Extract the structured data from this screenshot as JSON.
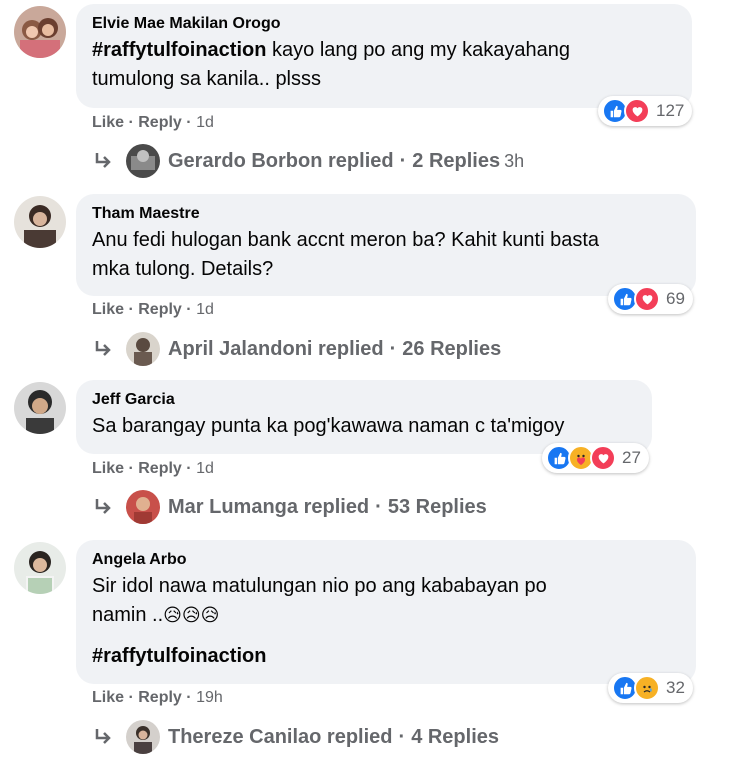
{
  "comments": [
    {
      "author": "Elvie Mae Makilan Orogo",
      "hashtag": "#raffytulfoinaction",
      "text_line1": "kayo lang po ang my kakayahang",
      "text_line2": "tumulong sa kanila.. plsss",
      "reaction_count": "127",
      "reactions": [
        "like-icon",
        "love-icon"
      ],
      "like": "Like",
      "reply": "Reply",
      "time": "1d",
      "reply_author": "Gerardo Borbon replied",
      "reply_count": "2 Replies",
      "reply_time": "3h"
    },
    {
      "author": "Tham Maestre",
      "text_line1": "Anu fedi hulogan bank accnt meron ba? Kahit kunti basta",
      "text_line2": "mka tulong. Details?",
      "reaction_count": "69",
      "reactions": [
        "like-icon",
        "love-icon"
      ],
      "like": "Like",
      "reply": "Reply",
      "time": "1d",
      "reply_author": "April Jalandoni replied",
      "reply_count": "26 Replies"
    },
    {
      "author": "Jeff Garcia",
      "text_line1": "Sa barangay punta ka pog'kawawa naman c ta'migoy",
      "reaction_count": "27",
      "reactions": [
        "like-icon",
        "care-icon",
        "love-icon"
      ],
      "like": "Like",
      "reply": "Reply",
      "time": "1d",
      "reply_author": "Mar Lumanga replied",
      "reply_count": "53 Replies"
    },
    {
      "author": "Angela Arbo",
      "text_line1": "Sir idol nawa matulungan nio po ang kababayan po",
      "text_line2": "namin ..",
      "emoji": "😥😥😥",
      "hashtag": "#raffytulfoinaction",
      "reaction_count": "32",
      "reactions": [
        "like-icon",
        "sad-icon"
      ],
      "like": "Like",
      "reply": "Reply",
      "time": "19h",
      "reply_author": "Thereze Canilao replied",
      "reply_count": "4 Replies"
    }
  ],
  "separator": "·",
  "colors": {
    "bubble": "#f0f2f5",
    "secondary_text": "#65676b",
    "like_blue": "#1877f2",
    "love_red": "#f33e58",
    "care_yellow": "#f7b125"
  }
}
